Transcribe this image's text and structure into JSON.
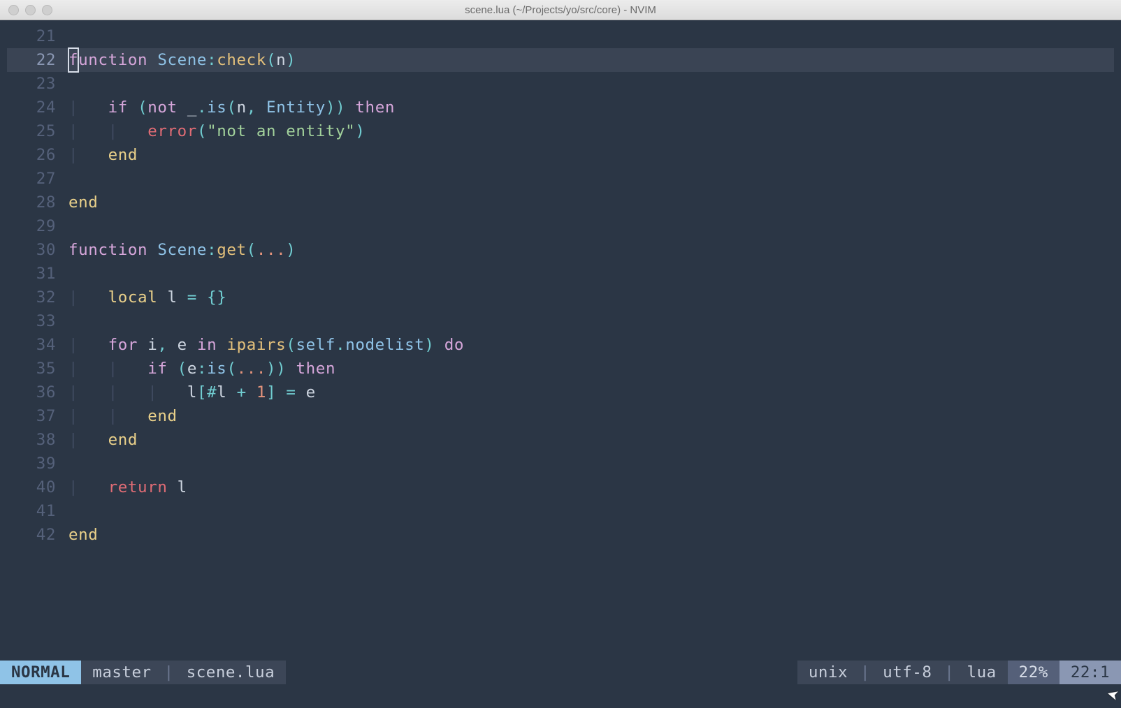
{
  "titlebar": {
    "title": "scene.lua (~/Projects/yo/src/core) - NVIM"
  },
  "gutter": {
    "l21": "21",
    "l22": "22",
    "l23": "23",
    "l24": "24",
    "l25": "25",
    "l26": "26",
    "l27": "27",
    "l28": "28",
    "l29": "29",
    "l30": "30",
    "l31": "31",
    "l32": "32",
    "l33": "33",
    "l34": "34",
    "l35": "35",
    "l36": "36",
    "l37": "37",
    "l38": "38",
    "l39": "39",
    "l40": "40",
    "l41": "41",
    "l42": "42"
  },
  "tok": {
    "function": "function",
    "Scene": "Scene",
    "check": "check",
    "n": "n",
    "if": "if",
    "not": "not",
    "underscore": "_",
    "is": "is",
    "Entity": "Entity",
    "then": "then",
    "error": "error",
    "str_not_entity": "\"not an entity\"",
    "end": "end",
    "get": "get",
    "local": "local",
    "l": "l",
    "for": "for",
    "i": "i",
    "e": "e",
    "in": "in",
    "ipairs": "ipairs",
    "self": "self",
    "nodelist": "nodelist",
    "do": "do",
    "hash": "#",
    "one": "1",
    "return": "return",
    "colon": ":",
    "dot": ".",
    "comma": ", ",
    "lpar": "(",
    "rpar": ")",
    "lbrace": "{",
    "rbrace": "}",
    "lbrk": "[",
    "rbrk": "]",
    "eq": " = ",
    "plus": " + ",
    "sp": " ",
    "pipe": "|",
    "dots": "..."
  },
  "status": {
    "mode": "NORMAL",
    "branch": "master",
    "file": "scene.lua",
    "format": "unix",
    "encoding": "utf-8",
    "filetype": "lua",
    "percent": "22%",
    "position": "22:1",
    "sep": " | "
  }
}
